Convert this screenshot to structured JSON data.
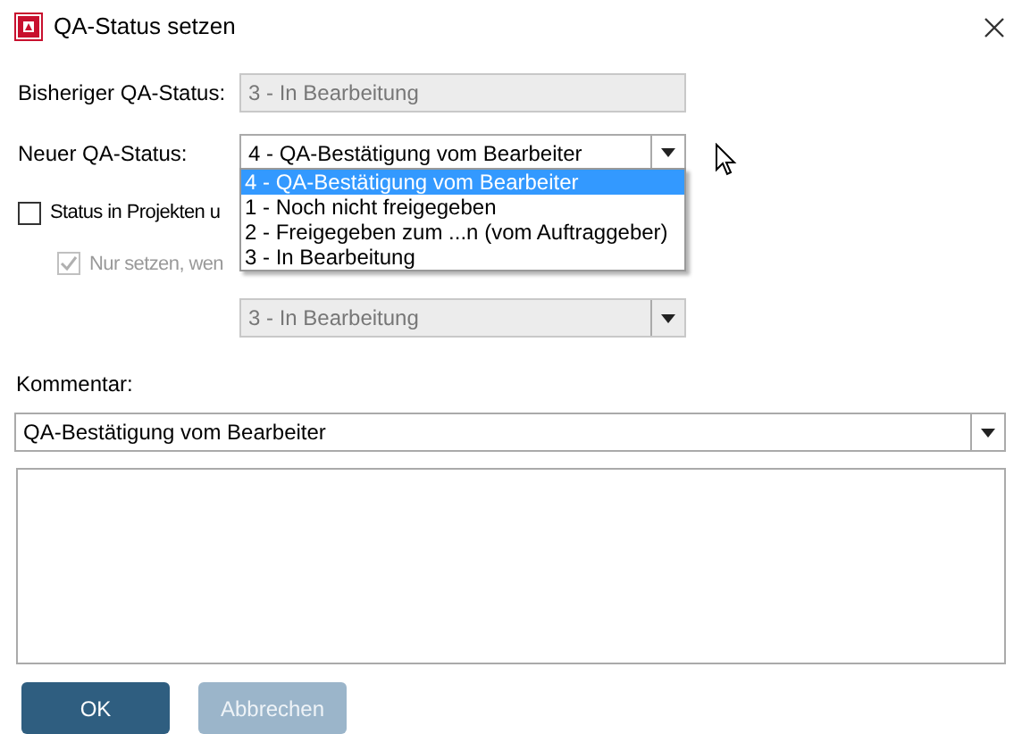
{
  "window": {
    "title": "QA-Status setzen"
  },
  "previous_status": {
    "label": "Bisheriger QA-Status:",
    "value": "3 - In Bearbeitung",
    "disabled": true
  },
  "new_status": {
    "label": "Neuer QA-Status:",
    "value": "4 - QA-Bestätigung vom Bearbeiter",
    "expanded": true,
    "options": [
      {
        "label": "4 - QA-Bestätigung vom Bearbeiter",
        "selected": true
      },
      {
        "label": "1 - Noch nicht freigegeben",
        "selected": false
      },
      {
        "label": "2 - Freigegeben zum ...n (vom Auftraggeber)",
        "selected": false
      },
      {
        "label": "3 - In Bearbeitung",
        "selected": false
      }
    ]
  },
  "projects_checkbox": {
    "label": "Status in Projekten u",
    "checked": false,
    "disabled": false
  },
  "only_if_checkbox": {
    "label": "Nur setzen, wen",
    "checked": true,
    "disabled": true
  },
  "condition_status": {
    "value": "3 - In Bearbeitung",
    "disabled": true
  },
  "comment": {
    "label": "Kommentar:",
    "value": "QA-Bestätigung vom Bearbeiter"
  },
  "buttons": [
    {
      "label": "OK",
      "disabled": false
    },
    {
      "label": "Abbrechen",
      "disabled": true
    }
  ]
}
